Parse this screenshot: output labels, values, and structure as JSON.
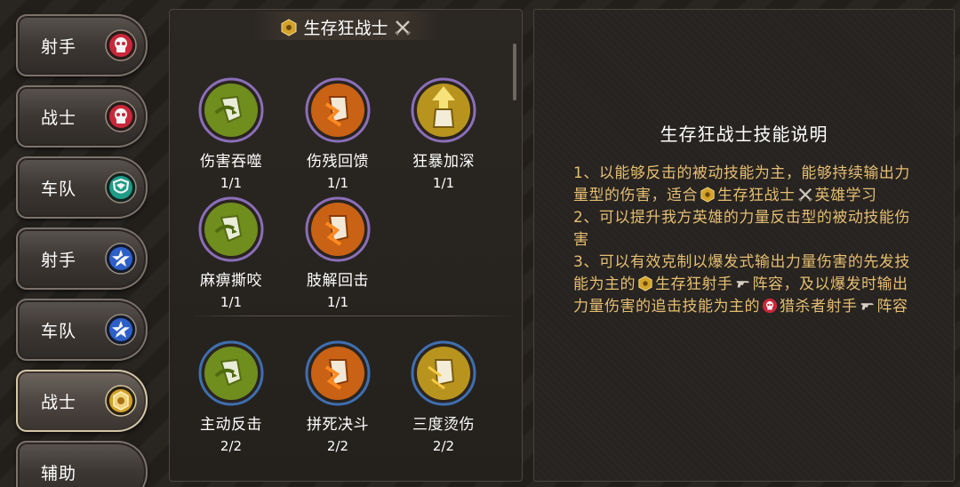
{
  "sidebar": {
    "tabs": [
      {
        "label": "射手",
        "icon": "red-skull-badge-icon"
      },
      {
        "label": "战士",
        "icon": "red-skull-badge-icon"
      },
      {
        "label": "车队",
        "icon": "teal-shield-badge-icon"
      },
      {
        "label": "射手",
        "icon": "blue-star-badge-icon"
      },
      {
        "label": "车队",
        "icon": "blue-star-badge-icon"
      },
      {
        "label": "战士",
        "icon": "gold-hexagon-badge-icon",
        "active": true
      },
      {
        "label": "辅助",
        "icon": ""
      }
    ]
  },
  "skills_panel": {
    "title": "生存狂战士",
    "title_icon": "gold-hexagon-icon",
    "title_trailing_icon": "crossed-swords-icon",
    "group1": [
      {
        "name": "伤害吞噬",
        "level": "1/1",
        "color": "green"
      },
      {
        "name": "伤残回馈",
        "level": "1/1",
        "color": "orange"
      },
      {
        "name": "狂暴加深",
        "level": "1/1",
        "color": "gold"
      },
      {
        "name": "麻痹撕咬",
        "level": "1/1",
        "color": "green"
      },
      {
        "name": "肢解回击",
        "level": "1/1",
        "color": "orange"
      }
    ],
    "group2": [
      {
        "name": "主动反击",
        "level": "2/2",
        "color": "green"
      },
      {
        "name": "拼死决斗",
        "level": "2/2",
        "color": "orange"
      },
      {
        "name": "三度烫伤",
        "level": "2/2",
        "color": "gold"
      }
    ]
  },
  "description": {
    "title": "生存狂战士技能说明",
    "p1_a": "1、以能够反击的被动技能为主，能够持续输出力量型的伤害，适合",
    "p1_b": "生存狂战士",
    "p1_c": "英雄学习",
    "p2": "2、可以提升我方英雄的力量反击型的被动技能伤害",
    "p3_a": "3、可以有效克制以爆发式输出力量伤害的先发技能为主的",
    "p3_b": "生存狂射手",
    "p3_c": "阵容，及以爆发时输出力量伤害的追击技能为主的",
    "p3_d": "猎杀者射手",
    "p3_e": "阵容"
  },
  "colors": {
    "accent_text": "#e6be72",
    "badge_red": "#c8283a",
    "badge_teal": "#1e9c86",
    "badge_blue": "#2c5fc8",
    "badge_gold": "#d4a22a"
  }
}
